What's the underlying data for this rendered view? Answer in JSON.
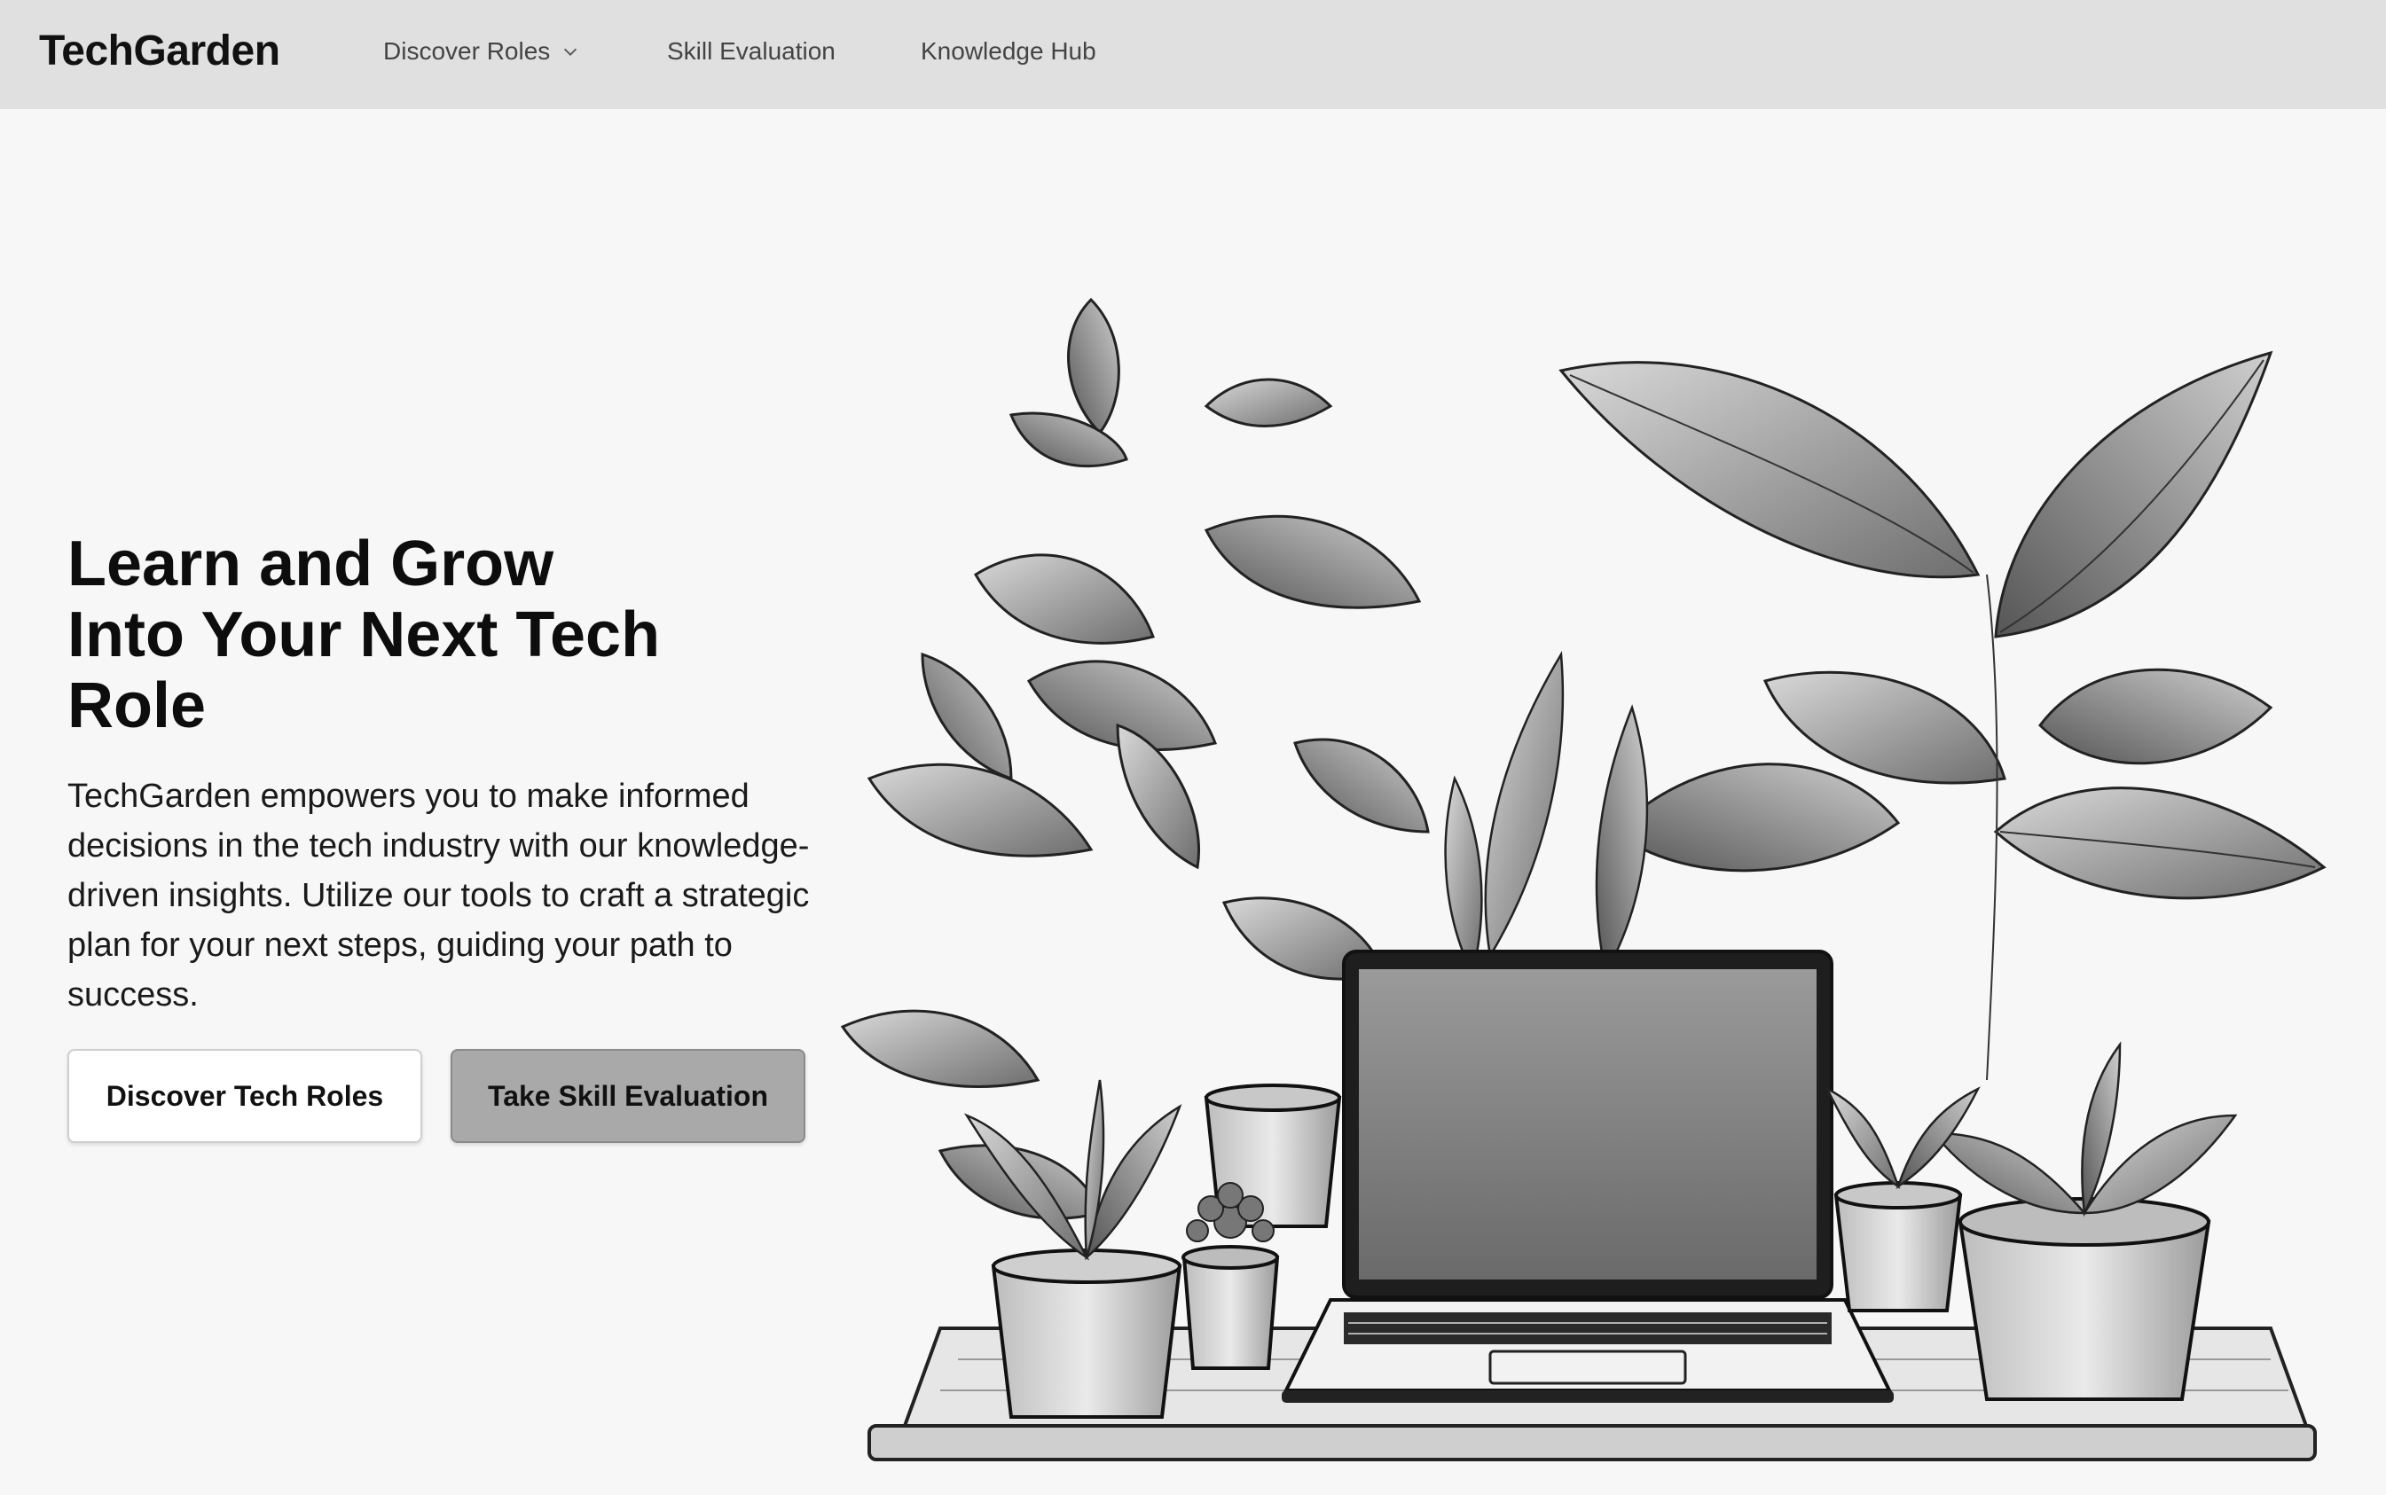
{
  "nav": {
    "brand": "TechGarden",
    "items": [
      {
        "label": "Discover Roles",
        "has_dropdown": true,
        "icon": "chevron-down-icon"
      },
      {
        "label": "Skill Evaluation"
      },
      {
        "label": "Knowledge Hub"
      }
    ]
  },
  "hero": {
    "title_line1": "Learn and Grow",
    "title_line2": "Into Your Next Tech",
    "title_line3": "Role",
    "description": "TechGarden empowers you to make informed decisions in the tech industry with our knowledge-driven insights. Utilize our tools to craft a strategic plan for your next steps, guiding your path to success.",
    "primary_button": "Discover Tech Roles",
    "secondary_button": "Take Skill Evaluation"
  },
  "colors": {
    "nav_bg": "#e0e0e0",
    "page_bg": "#f7f7f7",
    "secondary_button_bg": "#a9a9a9"
  }
}
